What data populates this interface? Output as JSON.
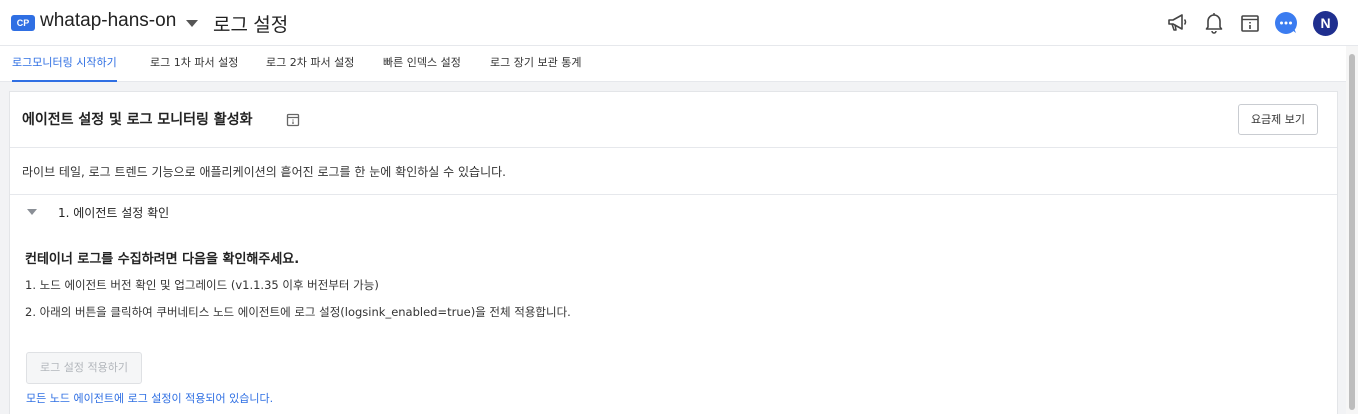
{
  "header": {
    "project_badge": "CP",
    "project_name": "whatap-hans-on",
    "page_title": "로그 설정",
    "avatar_initial": "N",
    "icons": [
      "megaphone-icon",
      "bell-icon",
      "info-panel-icon",
      "chat-icon"
    ]
  },
  "tabs": [
    {
      "label": "로그모니터링 시작하기",
      "active": true
    },
    {
      "label": "로그 1차 파서 설정",
      "active": false
    },
    {
      "label": "로그 2차 파서 설정",
      "active": false
    },
    {
      "label": "빠른 인덱스 설정",
      "active": false
    },
    {
      "label": "로그 장기 보관 통계",
      "active": false
    }
  ],
  "card": {
    "title": "에이전트 설정 및 로그 모니터링 활성화",
    "pricing_button": "요금제 보기",
    "description": "라이브 테일, 로그 트렌드 기능으로 애플리케이션의 흩어진 로그를 한 눈에 확인하실 수 있습니다.",
    "step": {
      "title": "1. 에이전트 설정 확인",
      "heading": "컨테이너 로그를 수집하려면 다음을 확인해주세요.",
      "lines": [
        "1. 노드 에이전트 버전 확인 및 업그레이드 (v1.1.35 이후 버전부터 가능)",
        "2. 아래의 버튼을 클릭하여 쿠버네티스 노드 에이전트에 로그 설정(logsink_enabled=true)을 전체 적용합니다."
      ],
      "apply_button": "로그 설정 적용하기",
      "status_note": "모든 노드 에이전트에 로그 설정이 적용되어 있습니다."
    }
  },
  "colors": {
    "accent": "#2f6fe3",
    "avatar": "#1f2f8f",
    "chat": "#3b7cf0"
  }
}
